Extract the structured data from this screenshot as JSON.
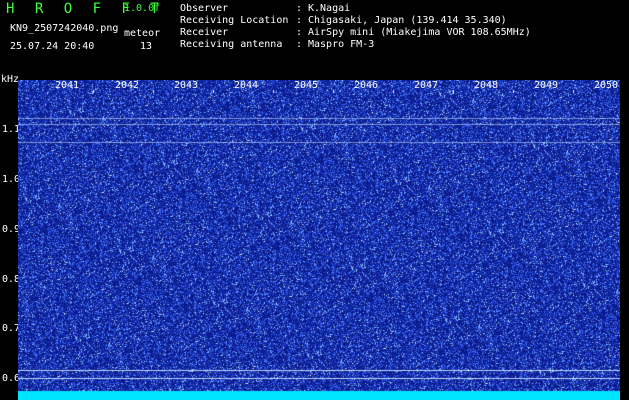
{
  "header": {
    "app_title": "H R O F F T",
    "version": "1.0.0f",
    "filename": "KN9_2507242040.png",
    "datetime": "25.07.24 20:40",
    "meteor_label": "meteor",
    "meteor_count": "13"
  },
  "info": [
    {
      "label": "Observer",
      "value": "K.Nagai"
    },
    {
      "label": "Receiving Location",
      "value": "Chigasaki, Japan (139.414 35.340)"
    },
    {
      "label": "Receiver",
      "value": "AirSpy mini (Miakejima VOR 108.65MHz)"
    },
    {
      "label": "Receiving antenna",
      "value": "Maspro FM-3"
    }
  ],
  "separator": ":",
  "plot": {
    "y_unit": "kHz",
    "y_ticks": [
      "1.1",
      "1.0",
      "0.9",
      "0.8",
      "0.7",
      "0.6"
    ],
    "x_ticks": [
      "2041",
      "2042",
      "2043",
      "2044",
      "2045",
      "2046",
      "2047",
      "2048",
      "2049",
      "2050"
    ],
    "colors": {
      "background": "#0a1a8a",
      "noise": "#4a7aff",
      "line": "#cfe8ff",
      "bottom_band": "#00e5ff"
    }
  }
}
